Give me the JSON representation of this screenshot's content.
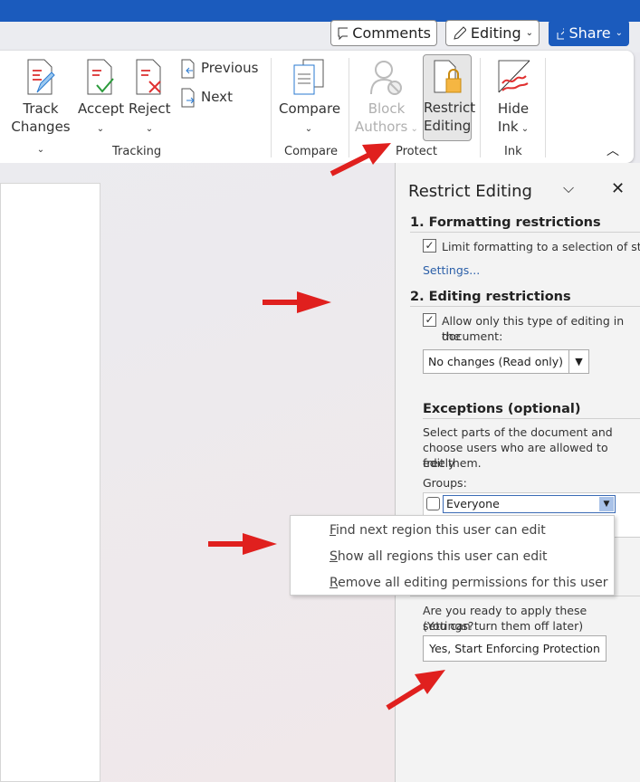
{
  "header": {
    "comments": "Comments",
    "editing": "Editing",
    "share": "Share"
  },
  "ribbon": {
    "track_changes": [
      "Track",
      "Changes"
    ],
    "accept": "Accept",
    "reject": "Reject",
    "previous": "Previous",
    "next": "Next",
    "compare": "Compare",
    "block_authors": [
      "Block",
      "Authors"
    ],
    "restrict_editing": [
      "Restrict",
      "Editing"
    ],
    "hide_ink": [
      "Hide",
      "Ink"
    ],
    "groups": {
      "tracking": "Tracking",
      "compare": "Compare",
      "protect": "Protect",
      "ink": "Ink"
    }
  },
  "pane": {
    "title": "Restrict Editing",
    "formatting_heading": "1. Formatting restrictions",
    "formatting_checkbox": "Limit formatting to a selection of styles",
    "formatting_checked": true,
    "settings_link": "Settings...",
    "editing_heading": "2. Editing restrictions",
    "editing_checkbox_1": "Allow only this type of editing in the",
    "editing_checkbox_2": "document:",
    "editing_checked": true,
    "editing_type": "No changes (Read only)",
    "exceptions_heading": "Exceptions (optional)",
    "exceptions_desc": [
      "Select parts of the document and",
      "choose users who are allowed to freely",
      "edit them."
    ],
    "groups_label": "Groups:",
    "group_everyone": "Everyone",
    "everyone_checked": false,
    "apply_question": [
      "Are you ready to apply these settings?",
      "(You can turn them off later)"
    ],
    "enforce_button": "Yes, Start Enforcing Protection"
  },
  "context_menu": {
    "items": [
      {
        "key": "F",
        "rest": "ind next region this user can edit"
      },
      {
        "key": "S",
        "rest": "how all regions this user can edit"
      },
      {
        "key": "R",
        "rest": "emove all editing permissions for this user"
      }
    ]
  },
  "colors": {
    "accent": "#1b5bbd",
    "annotation_arrow": "#e0201e"
  }
}
